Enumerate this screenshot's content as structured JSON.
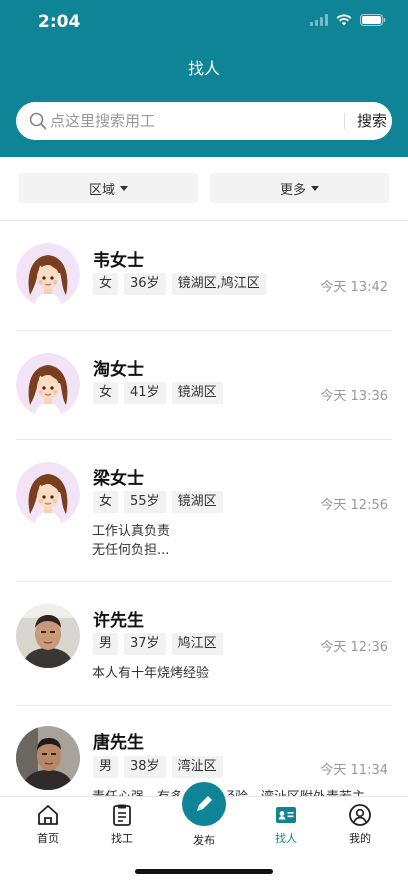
{
  "status_bar": {
    "time": "2:04"
  },
  "header": {
    "title": "找人"
  },
  "search": {
    "placeholder": "点这里搜索用工",
    "button_label": "搜索"
  },
  "filters": [
    {
      "label": "区域"
    },
    {
      "label": "更多"
    }
  ],
  "people": [
    {
      "name": "韦女士",
      "gender": "女",
      "age": "36岁",
      "location": "镜湖区,鸠江区",
      "time": "今天 13:42",
      "description": "",
      "avatar": "female-cartoon-avatar"
    },
    {
      "name": "淘女士",
      "gender": "女",
      "age": "41岁",
      "location": "镜湖区",
      "time": "今天 13:36",
      "description": "",
      "avatar": "female-cartoon-avatar"
    },
    {
      "name": "梁女士",
      "gender": "女",
      "age": "55岁",
      "location": "镜湖区",
      "time": "今天 12:56",
      "description": "工作认真负责\n无任何负担...",
      "avatar": "female-cartoon-avatar"
    },
    {
      "name": "许先生",
      "gender": "男",
      "age": "37岁",
      "location": "鸠江区",
      "time": "今天 12:36",
      "description": "本人有十年烧烤经验",
      "avatar": "male-photo-avatar"
    },
    {
      "name": "唐先生",
      "gender": "男",
      "age": "38岁",
      "location": "湾沚区",
      "time": "今天 11:34",
      "description": "责任心强，有多年行业经验，湾沚区附外责若主",
      "avatar": "male-photo-avatar"
    }
  ],
  "tabbar": {
    "home": "首页",
    "find_work": "找工",
    "publish": "发布",
    "find_people": "找人",
    "mine": "我的"
  },
  "colors": {
    "brand": "#0f8497",
    "tag_bg": "#f2f2f2",
    "avatar_bg": "#f3e3f7"
  }
}
